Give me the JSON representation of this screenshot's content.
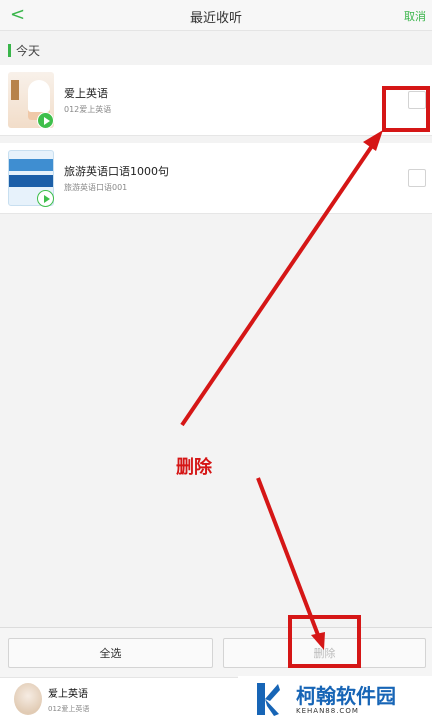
{
  "header": {
    "back_symbol": "<",
    "title": "最近收听",
    "cancel": "取消"
  },
  "section": {
    "label": "今天"
  },
  "items": [
    {
      "name": "爱上英语",
      "sub": "012爱上英语"
    },
    {
      "name": "旅游英语口语1000句",
      "sub": "旅游英语口语001"
    }
  ],
  "footer": {
    "select_all": "全选",
    "delete": "删除"
  },
  "player": {
    "title": "爱上英语",
    "sub": "012爱上英语"
  },
  "annotation": {
    "label": "删除"
  },
  "watermark": {
    "main": "柯翰软件园",
    "sub": "KEHAN88.COM"
  },
  "colors": {
    "accent": "#39b54a",
    "annotation": "#d51616",
    "watermark": "#1765b6"
  }
}
